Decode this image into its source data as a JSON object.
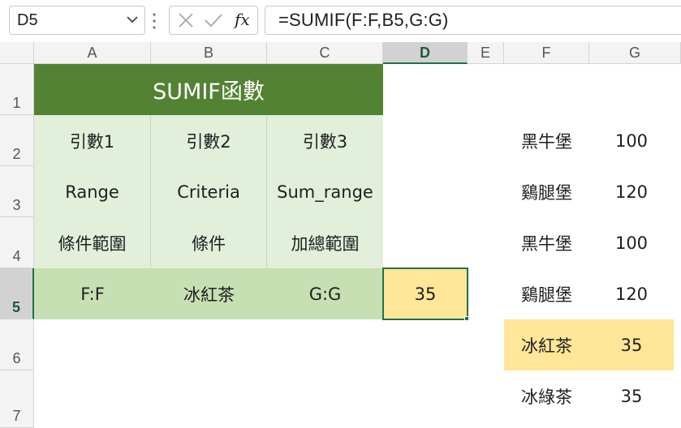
{
  "name_box": {
    "value": "D5"
  },
  "formula_bar": {
    "fx_label": "fx",
    "formula": "=SUMIF(F:F,B5,G:G)"
  },
  "columns": [
    "A",
    "B",
    "C",
    "D",
    "E",
    "F",
    "G"
  ],
  "rows": [
    "1",
    "2",
    "3",
    "4",
    "5",
    "6",
    "7"
  ],
  "table": {
    "title": "SUMIF函數",
    "arg_labels": [
      "引數1",
      "引數2",
      "引數3"
    ],
    "arg_names": [
      "Range",
      "Criteria",
      "Sum_range"
    ],
    "arg_desc": [
      "條件範圍",
      "條件",
      "加總範圍"
    ],
    "arg_values": [
      "F:F",
      "冰紅茶",
      "G:G"
    ]
  },
  "result": {
    "value": "35"
  },
  "side_list": [
    {
      "name": "黑牛堡",
      "value": "100"
    },
    {
      "name": "鷄腿堡",
      "value": "120"
    },
    {
      "name": "黑牛堡",
      "value": "100"
    },
    {
      "name": "鷄腿堡",
      "value": "120"
    },
    {
      "name": "冰紅茶",
      "value": "35"
    },
    {
      "name": "冰綠茶",
      "value": "35"
    }
  ],
  "colors": {
    "title_bg": "#548235",
    "light_green": "#e2efda",
    "mid_green": "#c6e0b4",
    "highlight": "#ffe699",
    "selection": "#217346"
  }
}
